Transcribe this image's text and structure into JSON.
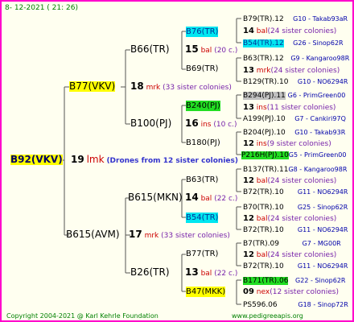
{
  "header": {
    "date": "8- 12-2021 ( 21: 26)"
  },
  "footer": {
    "copyright": "Copyright 2004-2021 @ Karl Kehrle Foundation",
    "website": "www.pedigreeapis.org"
  },
  "root": {
    "label": "B92(VKV)",
    "num": "19",
    "mating": "lmk",
    "colonies": "(Drones from 12 sister colonies)"
  },
  "gen1": {
    "top": {
      "label": "B77(VKV)",
      "num": "18",
      "mating": "mrk",
      "colonies": "(33 sister colonies)"
    },
    "bottom": {
      "label": "B615(AVM)",
      "num": "17",
      "mating": "mrk",
      "colonies": "(33 sister colonies)"
    }
  },
  "gen2": [
    {
      "label": "B66(TR)",
      "num": "15",
      "mating": "bal",
      "colonies": "(20 c.)"
    },
    {
      "label": "B100(PJ)",
      "num": "16",
      "mating": "ins",
      "colonies": "(10 c.)"
    },
    {
      "label": "B615(MKN)",
      "num": "14",
      "mating": "bal",
      "colonies": "(22 c.)"
    },
    {
      "label": "B26(TR)",
      "num": "13",
      "mating": "bal",
      "colonies": "(22 c.)"
    }
  ],
  "gen3": [
    {
      "label": "B76(TR)"
    },
    {
      "label": "B69(TR)"
    },
    {
      "label": "B240(PJ)"
    },
    {
      "label": "B180(PJ)"
    },
    {
      "label": "B63(TR)"
    },
    {
      "label": "B54(TR)"
    },
    {
      "label": "B77(TR)"
    },
    {
      "label": "B47(MKK)"
    }
  ],
  "gen4": [
    {
      "text": "B79(TR).12",
      "tail": "G10 - Takab93aR"
    },
    {
      "num": "14",
      "mating": "bal",
      "colonies": "(24 sister colonies)"
    },
    {
      "text": "B54(TR).12",
      "tail": "G26 - Sinop62R"
    },
    {
      "text": "B63(TR).12",
      "tail": "G9 - Kangaroo98R"
    },
    {
      "num": "13",
      "mating": "mrk",
      "colonies": "(24 sister colonies)"
    },
    {
      "text": "B129(TR).10",
      "tail": "G10 - NO6294R"
    },
    {
      "text": "B294(PJ).11",
      "tail": "G6 - PrimGreen00"
    },
    {
      "num": "13",
      "mating": "ins",
      "colonies": "(11 sister colonies)"
    },
    {
      "text": "A199(PJ).10",
      "tail": "G7 - Cankiri97Q"
    },
    {
      "text": "B204(PJ).10",
      "tail": "G10 - Takab93R"
    },
    {
      "num": "12",
      "mating": "ins",
      "colonies": "(9 sister colonies)"
    },
    {
      "text": "P216H(PJ).10",
      "tail": "G5 - PrimGreen00"
    },
    {
      "text": "B137(TR).11",
      "tail": "G8 - Kangaroo98R"
    },
    {
      "num": "12",
      "mating": "bal",
      "colonies": "(24 sister colonies)"
    },
    {
      "text": "B72(TR).10",
      "tail": "G11 - NO6294R"
    },
    {
      "text": "B70(TR).10",
      "tail": "G25 - Sinop62R"
    },
    {
      "num": "12",
      "mating": "bal",
      "colonies": "(24 sister colonies)"
    },
    {
      "text": "B72(TR).10",
      "tail": "G11 - NO6294R"
    },
    {
      "text": "B7(TR).09",
      "tail": "G7 - MG00R"
    },
    {
      "num": "12",
      "mating": "bal",
      "colonies": "(24 sister colonies)"
    },
    {
      "text": "B72(TR).10",
      "tail": "G11 - NO6294R"
    },
    {
      "text": "B171(TR).06",
      "tail": "G22 - Sinop62R"
    },
    {
      "num": "09",
      "mating": "nex",
      "colonies": "(12 sister colonies)"
    },
    {
      "text": "PS596.06",
      "tail": "G18 - Sinop72R"
    }
  ]
}
